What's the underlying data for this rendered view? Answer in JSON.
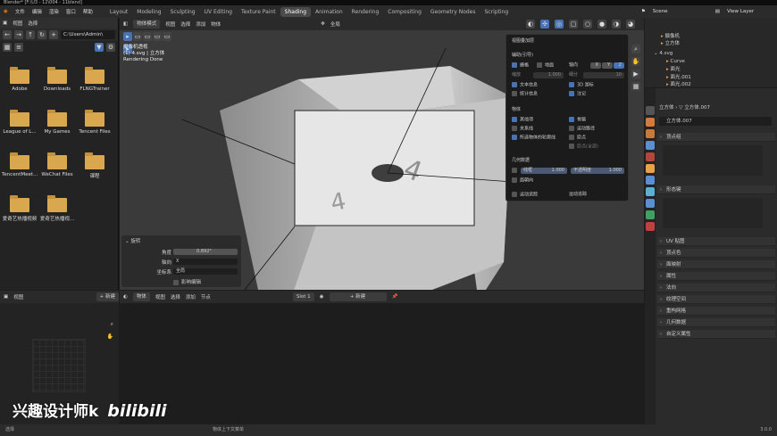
{
  "titlebar": {
    "text": "Blender* [F:\\U3 - 12\\004 - 11blend]"
  },
  "menus": [
    "文件",
    "编辑",
    "渲染",
    "窗口",
    "帮助"
  ],
  "workspace_tabs": [
    {
      "label": "Layout",
      "active": false
    },
    {
      "label": "Modeling",
      "active": false
    },
    {
      "label": "Sculpting",
      "active": false
    },
    {
      "label": "UV Editing",
      "active": false
    },
    {
      "label": "Texture Paint",
      "active": false
    },
    {
      "label": "Shading",
      "active": true
    },
    {
      "label": "Animation",
      "active": false
    },
    {
      "label": "Rendering",
      "active": false
    },
    {
      "label": "Compositing",
      "active": false
    },
    {
      "label": "Geometry Nodes",
      "active": false
    },
    {
      "label": "Scripting",
      "active": false
    }
  ],
  "scene": {
    "label": "Scene",
    "view_layer": "View Layer"
  },
  "file_browser": {
    "header": [
      "视图",
      "选择"
    ],
    "path": "C:\\Users\\Admin\\",
    "folders": [
      "Adobe",
      "Downloads",
      "FLNGTrainer",
      "League of L...",
      "My Games",
      "Tencent Files",
      "TencentMeet...",
      "WeChat Files",
      "课程",
      "爱奇艺热播视频",
      "爱奇艺热播视..."
    ]
  },
  "viewport": {
    "mode": "物体模式",
    "menus": [
      "视图",
      "选择",
      "添加",
      "物体"
    ],
    "transform": "全局",
    "info_lines": [
      "摄像机透视",
      "(1) 4.svg | 立方体",
      "Rendering Done"
    ]
  },
  "overlays": {
    "title": "视图叠加层",
    "guides_label": "辅助(引导)",
    "grid_label": "栅格",
    "floor_label": "地面",
    "axis_label": "轴向",
    "axes": [
      "X",
      "Y",
      "Z"
    ],
    "scale_label": "缩放",
    "scale_value": "1.000",
    "subdiv_label": "细分",
    "subdiv_value": "10",
    "text_info": "文本信息",
    "3d_cursor": "3D 游标",
    "stats": "统计信息",
    "annotations": "注记",
    "objects_label": "物体",
    "extras": "其他项",
    "bones": "骨骼",
    "relations": "关系线",
    "motion_paths": "运动路径",
    "outline": "所选物体的轮廓线",
    "origins": "原点",
    "origins_all": "原点(全部)",
    "geometry_label": "几何数据",
    "wireframe": "线框",
    "wireframe_value": "1.000",
    "xray_label": "不透明度",
    "xray_value": "1.000",
    "face_orient": "面朝向",
    "motion_track": "运动追踪",
    "motion_track2": "运动追踪"
  },
  "operator_panel": {
    "title": "旋转",
    "angle_label": "角度",
    "angle_value": "0.892°",
    "axis_label": "轴向",
    "axis_value": "X",
    "orient_label": "坐标系",
    "orient_value": "全局",
    "edit_label": "影响编辑"
  },
  "bottom_left": {
    "menus": [
      "视图"
    ],
    "new_label": "新建"
  },
  "shader": {
    "menus": [
      "物体",
      "视图",
      "选择",
      "添加",
      "节点"
    ],
    "slot": "Slot 1",
    "new_label": "新建"
  },
  "outliner": {
    "rows": [
      "摄像机",
      "立方体",
      "4.svg",
      "Curve",
      "面光",
      "面光.001",
      "面光.002"
    ]
  },
  "properties": {
    "breadcrumb_a": "立方体",
    "breadcrumb_b": "立方体.007",
    "mesh_name": "立方体.007",
    "sections": [
      "顶点组",
      "形态键",
      "UV 贴图",
      "顶点色",
      "面映射",
      "属性",
      "法向",
      "纹理空间",
      "重构网格",
      "几何数据",
      "自定义属性"
    ]
  },
  "status": {
    "left": "选择",
    "mid": "物体上下文菜单",
    "version": "3.0.0"
  },
  "watermark": {
    "text": "兴趣设计师k",
    "logo": "bilibili"
  }
}
